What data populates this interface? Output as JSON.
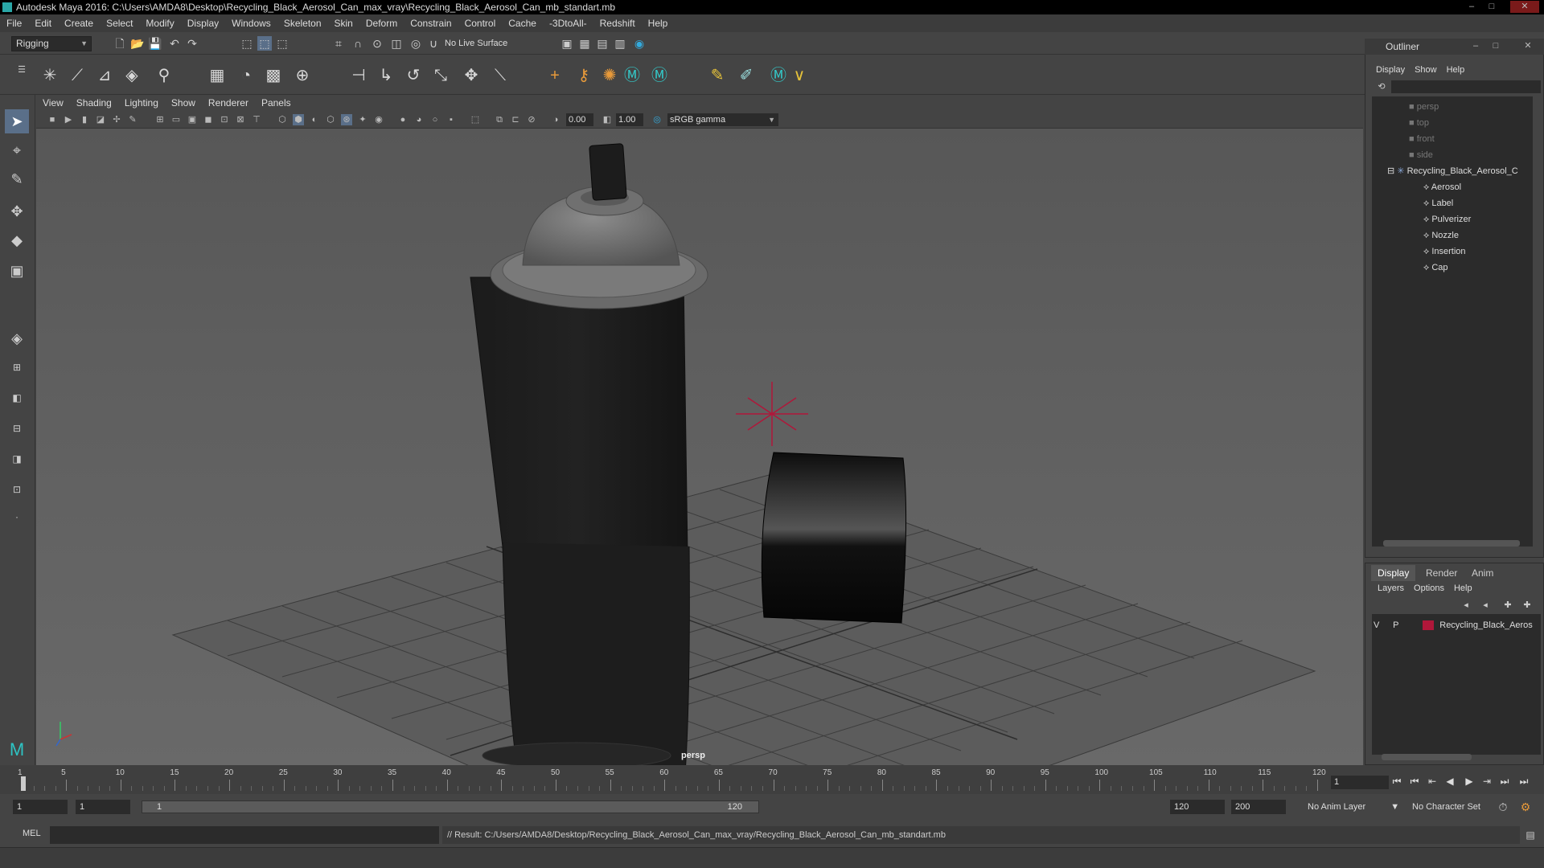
{
  "window": {
    "title": "Autodesk Maya 2016: C:\\Users\\AMDA8\\Desktop\\Recycling_Black_Aerosol_Can_max_vray\\Recycling_Black_Aerosol_Can_mb_standart.mb",
    "minimize": "–",
    "maximize": "□",
    "close": "✕"
  },
  "menubar": [
    "File",
    "Edit",
    "Create",
    "Select",
    "Modify",
    "Display",
    "Windows",
    "Skeleton",
    "Skin",
    "Deform",
    "Constrain",
    "Control",
    "Cache",
    "-3DtoAll-",
    "Redshift",
    "Help"
  ],
  "status_line": {
    "mode": "Rigging",
    "live_surface": "No Live Surface"
  },
  "panel_menu": [
    "View",
    "Shading",
    "Lighting",
    "Show",
    "Renderer",
    "Panels"
  ],
  "panel_toolbar": {
    "exposure": "0.00",
    "gamma": "1.00",
    "color_space": "sRGB gamma"
  },
  "viewport": {
    "camera_label": "persp"
  },
  "outliner": {
    "title": "Outliner",
    "menu": [
      "Display",
      "Show",
      "Help"
    ],
    "cameras": [
      "persp",
      "top",
      "front",
      "side"
    ],
    "group": "Recycling_Black_Aerosol_C",
    "children": [
      "Aerosol",
      "Label",
      "Pulverizer",
      "Nozzle",
      "Insertion",
      "Cap"
    ]
  },
  "layer_editor": {
    "tabs": [
      "Display",
      "Render",
      "Anim"
    ],
    "menu": [
      "Layers",
      "Options",
      "Help"
    ],
    "layer": {
      "v": "V",
      "p": "P",
      "name": "Recycling_Black_Aeros",
      "color": "#b0173a"
    }
  },
  "timeline": {
    "ticks": [
      "1",
      "5",
      "10",
      "15",
      "20",
      "25",
      "30",
      "35",
      "40",
      "45",
      "50",
      "55",
      "60",
      "65",
      "70",
      "75",
      "80",
      "85",
      "90",
      "95",
      "100",
      "105",
      "110",
      "115",
      "120"
    ],
    "current_frame": "1"
  },
  "range": {
    "start": "1",
    "playback_start": "1",
    "slider_start": "1",
    "slider_end": "120",
    "playback_end": "120",
    "end": "200",
    "anim_layer": "No Anim Layer",
    "character_set": "No Character Set"
  },
  "command_line": {
    "mode": "MEL",
    "result": "// Result: C:/Users/AMDA8/Desktop/Recycling_Black_Aerosol_Can_max_vray/Recycling_Black_Aerosol_Can_mb_standart.mb"
  },
  "colors": {
    "accent": "#5a6f89",
    "layer_color": "#b0173a"
  }
}
